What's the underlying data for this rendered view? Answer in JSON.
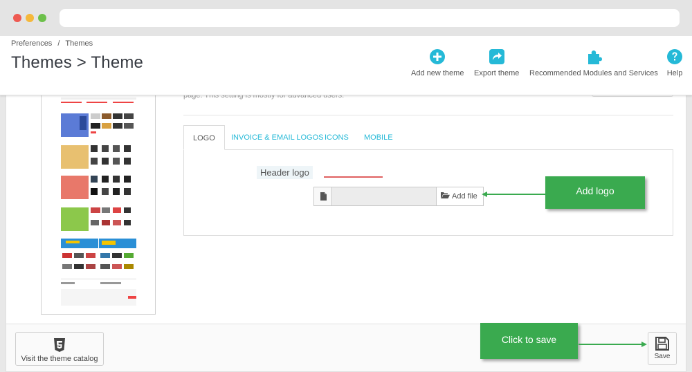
{
  "breadcrumb": {
    "item1": "Preferences",
    "separator": "/",
    "item2": "Themes"
  },
  "page_title": "Themes > Theme",
  "toolbar": {
    "add_new_theme": "Add new theme",
    "export_theme": "Export theme",
    "recommended": "Recommended Modules and Services",
    "help": "Help",
    "icons": [
      "plus-circle-icon",
      "export-icon",
      "puzzle-icon",
      "help-icon"
    ],
    "icon_color": "#25b9d7"
  },
  "description_fragment": "page. This setting is mostly for advanced users.",
  "tabs": [
    {
      "label": "LOGO",
      "active": true
    },
    {
      "label": "INVOICE & EMAIL LOGOS",
      "active": false
    },
    {
      "label": "ICONS",
      "active": false
    },
    {
      "label": "MOBILE",
      "active": false
    }
  ],
  "logo_panel": {
    "header_logo_label": "Header logo",
    "add_file_label": "Add file"
  },
  "footer": {
    "catalog_label": "Visit the theme catalog",
    "save_label": "Save"
  },
  "annotations": {
    "add_logo": "Add logo",
    "click_to_save": "Click to save",
    "color": "#3aaa4f"
  }
}
